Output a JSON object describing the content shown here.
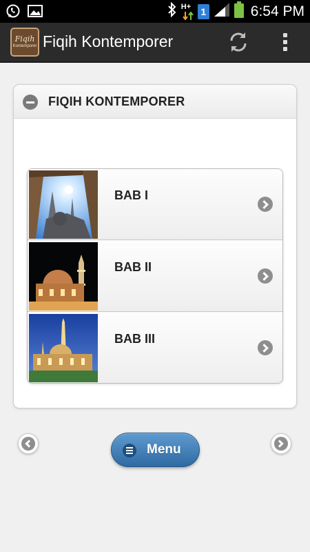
{
  "status_bar": {
    "time": "6:54 PM",
    "network_label": "H+",
    "sim_number": "1",
    "icons": [
      "whatsapp-icon",
      "image-icon",
      "bluetooth-icon",
      "network-hplus-icon",
      "sim-icon",
      "signal-icon",
      "battery-icon"
    ],
    "battery_color": "#7dc242"
  },
  "app_bar": {
    "logo_text": "Fiqih",
    "logo_subtext": "Kontemporer",
    "title": "Fiqih Kontemporer",
    "icons": [
      "refresh-icon",
      "overflow-menu-icon"
    ],
    "background": "#2b2b2b"
  },
  "section": {
    "title": "FIQIH KONTEMPORER",
    "expanded": true
  },
  "list": {
    "items": [
      {
        "label": "BAB I",
        "thumbnail": "mosque-minarets-sky-thumb"
      },
      {
        "label": "BAB II",
        "thumbnail": "mosque-night-dome-thumb"
      },
      {
        "label": "BAB III",
        "thumbnail": "mosque-dusk-lit-thumb"
      }
    ]
  },
  "footer": {
    "menu_label": "Menu",
    "accent": "#2f6aa2"
  }
}
